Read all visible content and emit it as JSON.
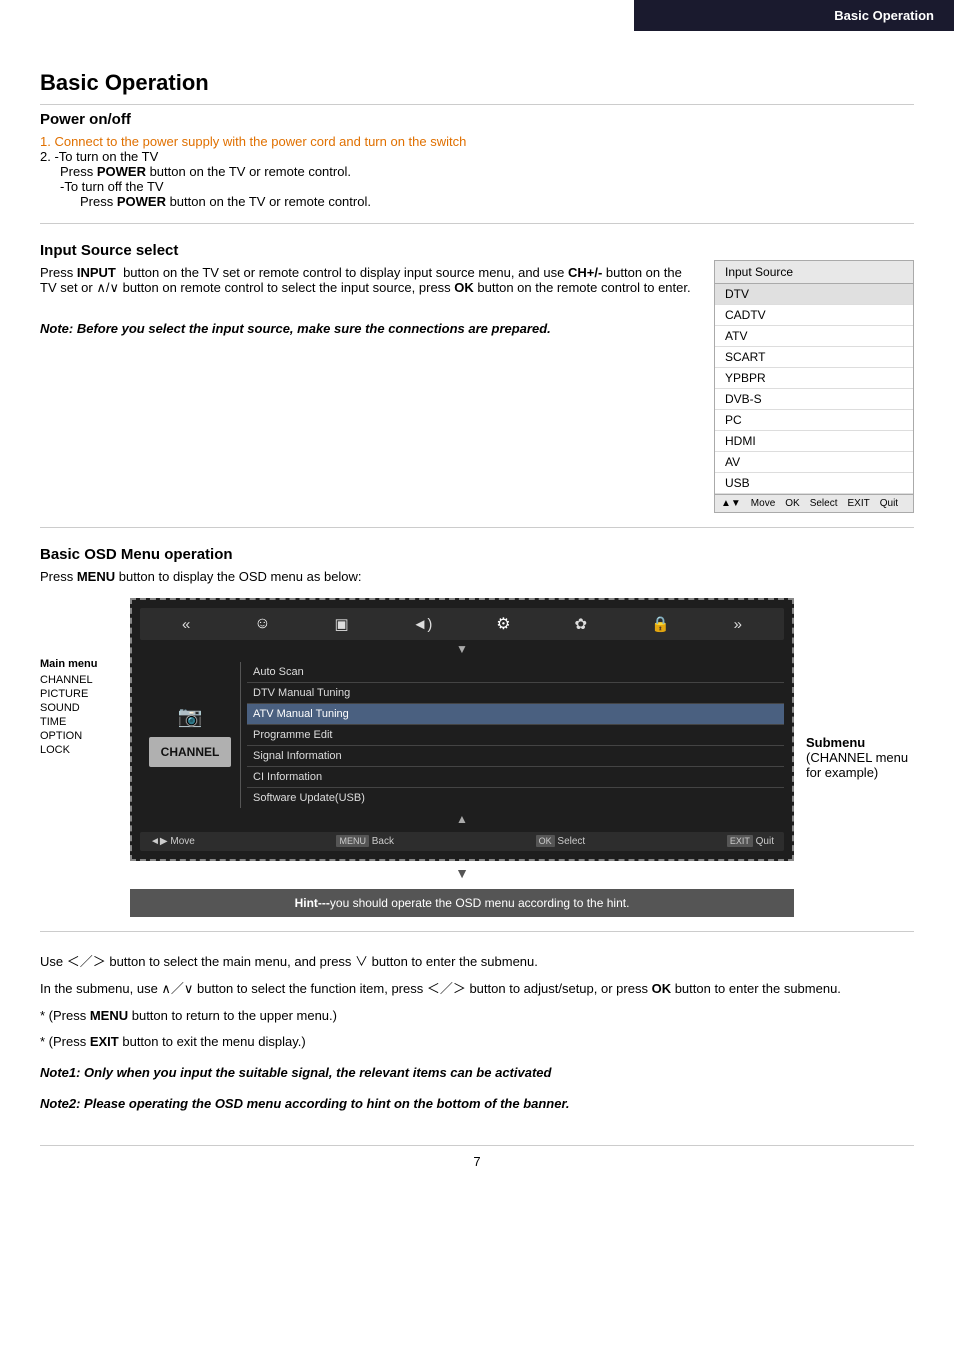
{
  "header": {
    "section_label": "Basic Operation"
  },
  "page": {
    "title": "Basic Operation",
    "number": "7"
  },
  "power_section": {
    "title": "Power on/off",
    "step1": "1. Connect to the power supply with the power cord and turn on the switch",
    "step2": "2. -To turn on the TV",
    "step2_indent": "Press POWER button on the TV or remote control.",
    "step3": "-To turn off the TV",
    "step3_indent": "Press POWER button on the TV or remote control."
  },
  "input_source_section": {
    "title": "Input Source select",
    "body": "Press INPUT  button on the TV set or remote control to display input source menu, and use CH+/- button on the TV set or ∧/∨ button on remote control to select the input source, press OK button on the remote control to enter.",
    "note_italic": "Note: Before you select the input source, make sure the connections are prepared.",
    "panel": {
      "header": "Input Source",
      "items": [
        "DTV",
        "CADTV",
        "ATV",
        "SCART",
        "YPBPR",
        "DVB-S",
        "PC",
        "HDMI",
        "AV",
        "USB"
      ],
      "highlighted_index": 0,
      "footer": {
        "move": "Move",
        "select": "Select",
        "quit": "Quit"
      }
    }
  },
  "osd_section": {
    "title": "Basic OSD Menu operation",
    "body": "Press MENU button to display the OSD menu as below:",
    "main_menu": {
      "label": "Main menu",
      "items": [
        "CHANNEL",
        "PICTURE",
        "SOUND",
        "TIME",
        "OPTION",
        "LOCK"
      ]
    },
    "icons": [
      "«",
      "☺",
      "▣",
      "◄)",
      "⚙",
      "✿",
      "🔒",
      "»"
    ],
    "channel_label": "CHANNEL",
    "submenu_items": [
      "Auto Scan",
      "DTV Manual Tuning",
      "ATV Manual Tuning",
      "Programme Edit",
      "Signal Information",
      "CI Information",
      "Software Update(USB)"
    ],
    "submenu_highlighted": 2,
    "bottom_bar": {
      "move": "◄▶ Move",
      "back": "MENU Back",
      "select": "OK Select",
      "quit": "EXIT Quit"
    },
    "hint": "Hint---you should operate the OSD menu according to the hint.",
    "submenu_label": "Submenu",
    "submenu_sublabel": "(CHANNEL menu",
    "submenu_sublabel2": "for example)"
  },
  "bottom_text": {
    "line1": "Use ＜／＞ button to select the main menu, and press ∨ button to enter the submenu.",
    "line2": "In the submenu, use ∧／∨ button to select the function item, press ＜／＞ button to adjust/setup, or press OK button to enter the submenu.",
    "bullet1": "* (Press MENU button to return to the upper menu.)",
    "bullet2": "* (Press EXIT button to exit the menu display.)",
    "note1": "Note1: Only when you input the suitable signal, the relevant items can be activated",
    "note2": "Note2: Please operating the OSD menu according to hint on the bottom of the banner."
  }
}
